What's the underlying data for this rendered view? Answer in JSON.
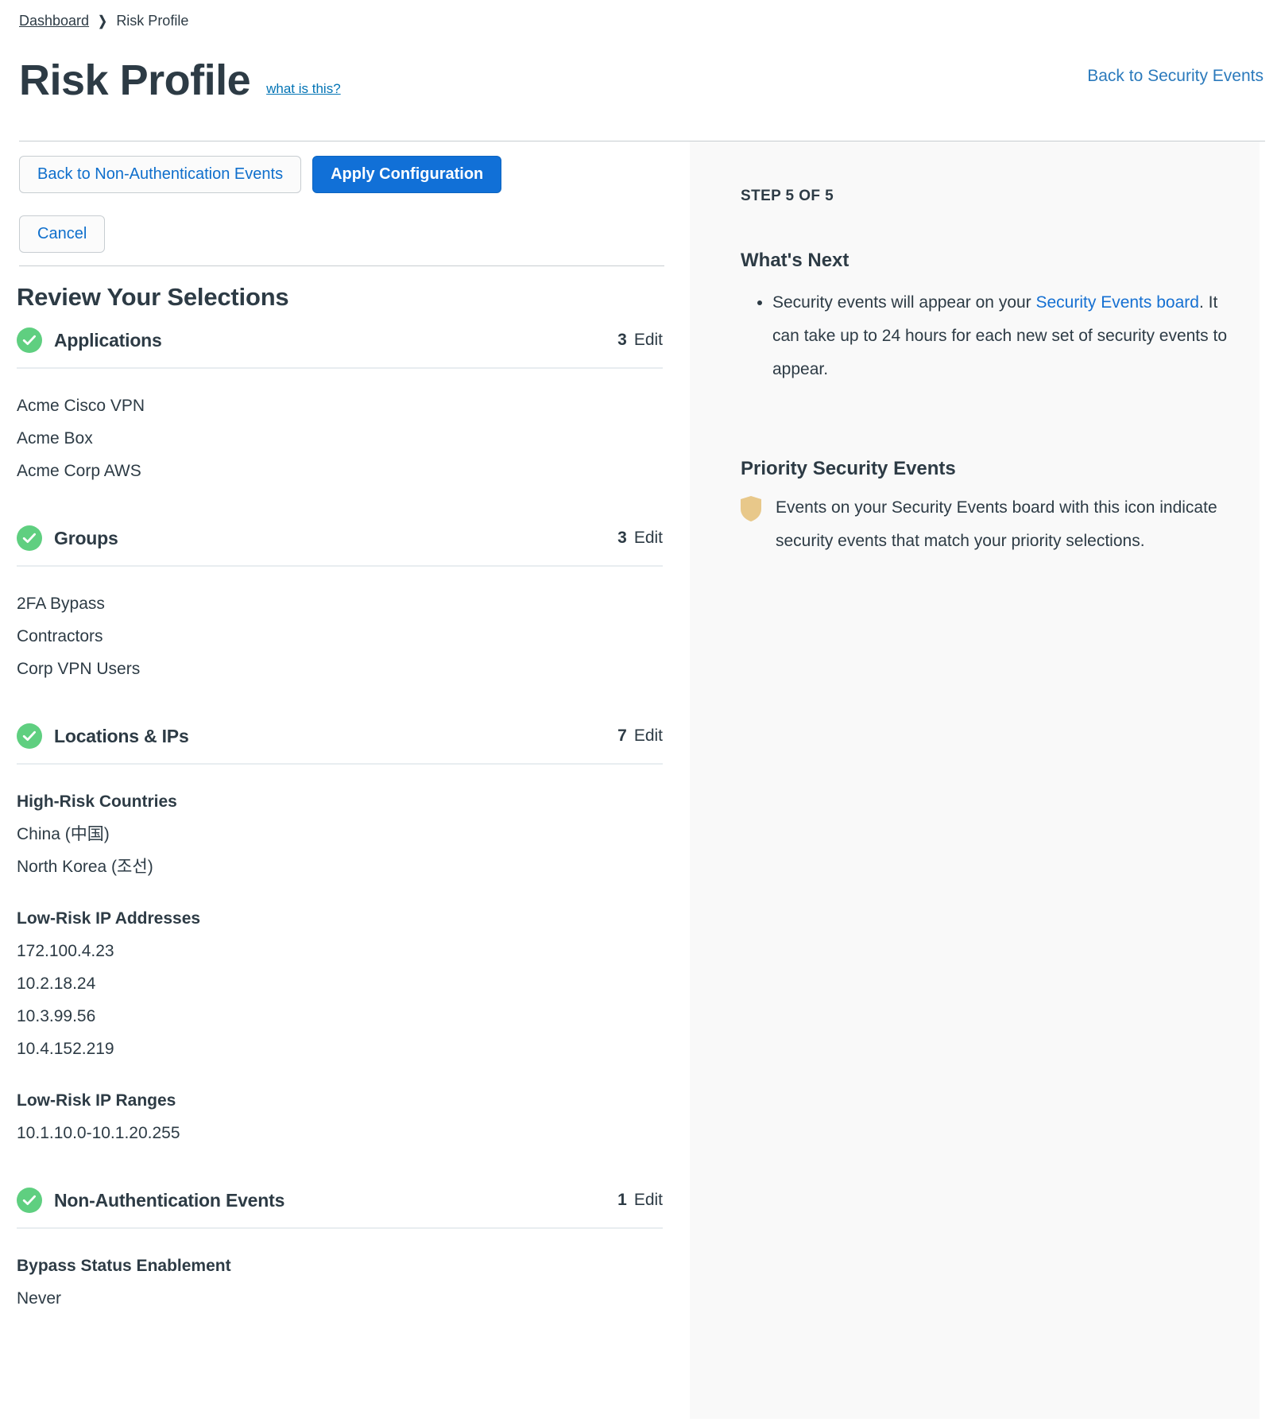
{
  "breadcrumb": {
    "parent": "Dashboard",
    "separator_icon": "chevron-right-icon",
    "current": "Risk Profile"
  },
  "header": {
    "title": "Risk Profile",
    "what_is_this": "what is this?",
    "back_to_security_events": "Back to Security Events"
  },
  "toolbar": {
    "back_label": "Back to Non-Authentication Events",
    "apply_label": "Apply Configuration",
    "cancel_label": "Cancel"
  },
  "review": {
    "heading": "Review Your Selections",
    "edit_label": "Edit",
    "sections": [
      {
        "name": "Applications",
        "count": "3",
        "status_icon": "check-circle-icon",
        "groups": [
          {
            "label": null,
            "items": [
              "Acme Cisco VPN",
              "Acme Box",
              "Acme Corp AWS"
            ]
          }
        ]
      },
      {
        "name": "Groups",
        "count": "3",
        "status_icon": "check-circle-icon",
        "groups": [
          {
            "label": null,
            "items": [
              "2FA Bypass",
              "Contractors",
              "Corp VPN Users"
            ]
          }
        ]
      },
      {
        "name": "Locations & IPs",
        "count": "7",
        "status_icon": "check-circle-icon",
        "groups": [
          {
            "label": "High-Risk Countries",
            "items": [
              "China (中国)",
              "North Korea (조선)"
            ]
          },
          {
            "label": "Low-Risk IP Addresses",
            "items": [
              "172.100.4.23",
              "10.2.18.24",
              "10.3.99.56",
              "10.4.152.219"
            ]
          },
          {
            "label": "Low-Risk IP Ranges",
            "items": [
              "10.1.10.0-10.1.20.255"
            ]
          }
        ]
      },
      {
        "name": "Non-Authentication Events",
        "count": "1",
        "status_icon": "check-circle-icon",
        "groups": [
          {
            "label": "Bypass Status Enablement",
            "items": [
              "Never"
            ]
          }
        ]
      }
    ]
  },
  "side_panel": {
    "step": "STEP 5 OF 5",
    "whats_next_title": "What's Next",
    "bullet_1_pre": "Security events will appear on your ",
    "bullet_1_link": "Security Events board",
    "bullet_1_post": ". It can take up to 24 hours for each new set of security events to appear.",
    "priority_title": "Priority Security Events",
    "priority_icon": "shield-icon",
    "priority_text": "Events on your Security Events board with this icon indicate security events that match your priority selections."
  },
  "colors": {
    "accent_blue": "#1170d7",
    "link_blue": "#1570d2",
    "success_green": "#5fcf80",
    "shield_gold": "#e8c88a",
    "text": "#2d3b45",
    "panel_bg": "#f9f9f9",
    "rule": "#c7cdd1"
  }
}
